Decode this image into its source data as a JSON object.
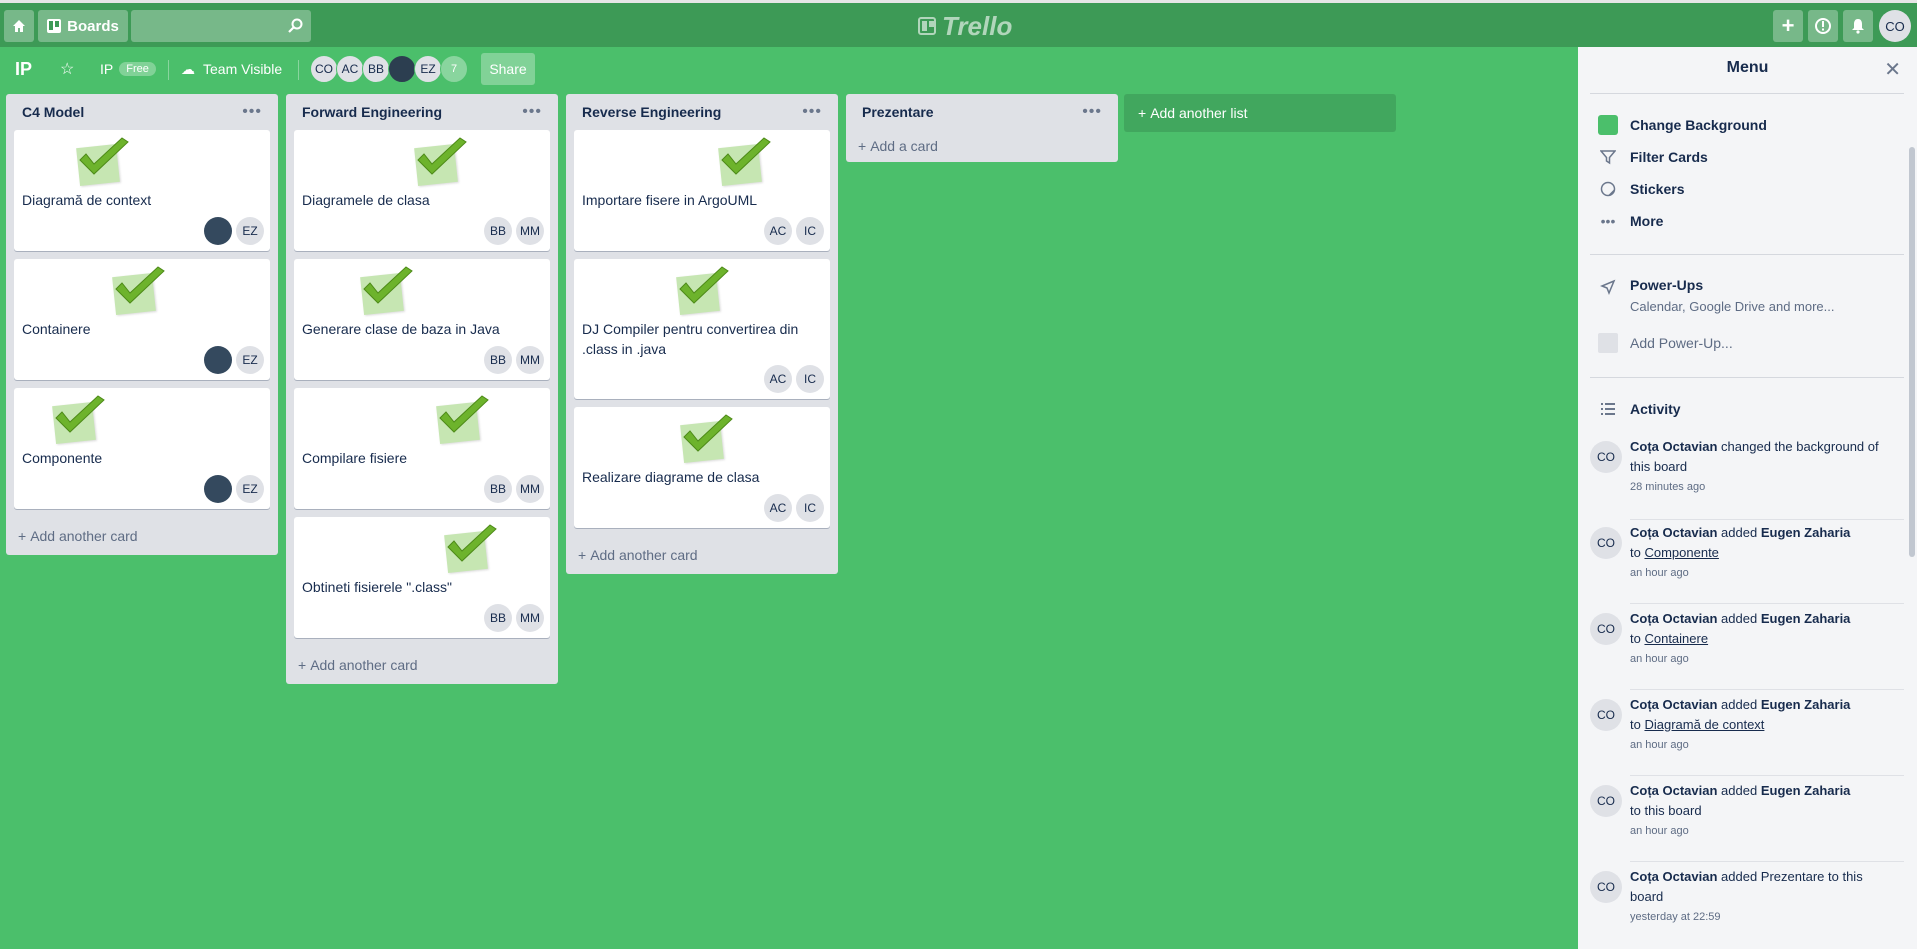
{
  "header": {
    "boards_label": "Boards",
    "search_placeholder": "",
    "logo_text": "Trello",
    "user_initials": "CO"
  },
  "board": {
    "title": "IP",
    "team_name": "IP",
    "plan_badge": "Free",
    "visibility": "Team Visible",
    "members": [
      "CO",
      "AC",
      "BB",
      "",
      "EZ"
    ],
    "members_more": "7",
    "share_label": "Share"
  },
  "lists": [
    {
      "title": "C4 Model",
      "cards": [
        {
          "title": "Diagramă de context",
          "members": [
            "",
            "EZ"
          ]
        },
        {
          "title": "Containere",
          "members": [
            "",
            "EZ"
          ]
        },
        {
          "title": "Componente",
          "members": [
            "",
            "EZ"
          ]
        }
      ],
      "add_label": "Add another card"
    },
    {
      "title": "Forward Engineering",
      "cards": [
        {
          "title": "Diagramele de clasa",
          "members": [
            "BB",
            "MM"
          ]
        },
        {
          "title": "Generare clase de baza in Java",
          "members": [
            "BB",
            "MM"
          ]
        },
        {
          "title": "Compilare fisiere",
          "members": [
            "BB",
            "MM"
          ]
        },
        {
          "title": "Obtineti fisierele \".class\"",
          "members": [
            "BB",
            "MM"
          ]
        }
      ],
      "add_label": "Add another card"
    },
    {
      "title": "Reverse Engineering",
      "cards": [
        {
          "title": "Importare fisere in ArgoUML",
          "members": [
            "AC",
            "IC"
          ]
        },
        {
          "title": "DJ Compiler pentru convertirea din .class in .java",
          "members": [
            "AC",
            "IC"
          ]
        },
        {
          "title": "Realizare diagrame de clasa",
          "members": [
            "AC",
            "IC"
          ]
        }
      ],
      "add_label": "Add another card"
    },
    {
      "title": "Prezentare",
      "cards": [],
      "add_label": "Add a card"
    }
  ],
  "add_list_label": "Add another list",
  "menu": {
    "title": "Menu",
    "items": [
      "Change Background",
      "Filter Cards",
      "Stickers",
      "More"
    ],
    "background_color": "#4bbf6b",
    "powerups_title": "Power-Ups",
    "powerups_subtitle": "Calendar, Google Drive and more...",
    "add_powerup": "Add Power-Up...",
    "activity_title": "Activity",
    "activity": [
      {
        "initials": "CO",
        "user": "Coța Octavian",
        "action": "changed the background of this board",
        "target": "",
        "card": "",
        "time": "28 minutes ago"
      },
      {
        "initials": "CO",
        "user": "Coța Octavian",
        "action": "added",
        "target": "Eugen Zaharia",
        "card": "Componente",
        "time": "an hour ago"
      },
      {
        "initials": "CO",
        "user": "Coța Octavian",
        "action": "added",
        "target": "Eugen Zaharia",
        "card": "Containere",
        "time": "an hour ago"
      },
      {
        "initials": "CO",
        "user": "Coța Octavian",
        "action": "added",
        "target": "Eugen Zaharia",
        "card": "Diagramă de context",
        "time": "an hour ago"
      },
      {
        "initials": "CO",
        "user": "Coța Octavian",
        "action": "added",
        "target": "Eugen Zaharia",
        "card": "",
        "time": "an hour ago"
      },
      {
        "initials": "CO",
        "user": "Coța Octavian",
        "action": "added Prezentare to this board",
        "target": "",
        "card": "",
        "time": "yesterday at 22:59"
      }
    ],
    "to_label": "to",
    "to_board_label": "to this board"
  }
}
